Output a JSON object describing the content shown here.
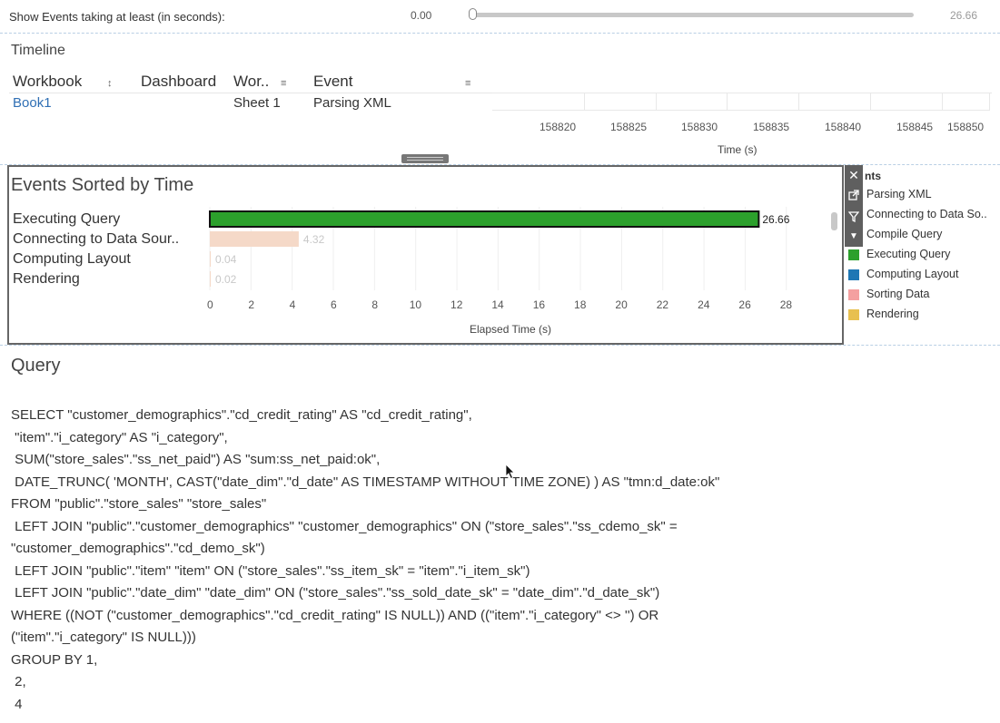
{
  "filter": {
    "label": "Show Events taking at least (in seconds):",
    "min_value": "0.00",
    "max_value": "26.66",
    "slider_level": 0
  },
  "timeline": {
    "title": "Timeline",
    "columns": [
      "Workbook",
      "Dashboard",
      "Wor..",
      "Event"
    ],
    "row": {
      "workbook": "Book1",
      "dashboard": "",
      "worksheet": "Sheet 1",
      "event": "Parsing XML"
    },
    "axis_ticks": [
      "158820",
      "158825",
      "158830",
      "158835",
      "158840",
      "158845",
      "158850"
    ],
    "axis_title": "Time (s)"
  },
  "events": {
    "title": "Events Sorted by Time",
    "x_axis_title": "Elapsed Time (s)",
    "ticks": [
      "0",
      "2",
      "4",
      "6",
      "8",
      "10",
      "12",
      "14",
      "16",
      "18",
      "20",
      "22",
      "24",
      "26",
      "28"
    ]
  },
  "chart_data": {
    "type": "bar",
    "orientation": "horizontal",
    "categories": [
      "Executing Query",
      "Connecting to Data Sour..",
      "Computing Layout",
      "Rendering"
    ],
    "values": [
      26.66,
      4.32,
      0.04,
      0.02
    ],
    "value_labels": [
      "26.66",
      "4.32",
      "0.04",
      "0.02"
    ],
    "colors": [
      "#2ca02c",
      "#f5d9c8",
      "#f5d9c8",
      "#f5d9c8"
    ],
    "xlabel": "Elapsed Time (s)",
    "xlim": [
      0,
      30
    ],
    "grid": true
  },
  "legend": {
    "title": "nts",
    "items": [
      {
        "label": "Parsing XML",
        "color": ""
      },
      {
        "label": "Connecting to Data So..",
        "color": ""
      },
      {
        "label": "Compile Query",
        "color": ""
      },
      {
        "label": "Executing Query",
        "color": "#2ca02c"
      },
      {
        "label": "Computing Layout",
        "color": "#1f77b4"
      },
      {
        "label": "Sorting Data",
        "color": "#f4a0a0"
      },
      {
        "label": "Rendering",
        "color": "#e8c050"
      }
    ]
  },
  "toolbar": {
    "icons": [
      "close-icon",
      "popout-icon",
      "filter-icon",
      "dropdown-icon"
    ]
  },
  "query": {
    "title": "Query",
    "text": "SELECT \"customer_demographics\".\"cd_credit_rating\" AS \"cd_credit_rating\",\n \"item\".\"i_category\" AS \"i_category\",\n SUM(\"store_sales\".\"ss_net_paid\") AS \"sum:ss_net_paid:ok\",\n DATE_TRUNC( 'MONTH', CAST(\"date_dim\".\"d_date\" AS TIMESTAMP WITHOUT TIME ZONE) ) AS \"tmn:d_date:ok\"\nFROM \"public\".\"store_sales\" \"store_sales\"\n LEFT JOIN \"public\".\"customer_demographics\" \"customer_demographics\" ON (\"store_sales\".\"ss_cdemo_sk\" =\n\"customer_demographics\".\"cd_demo_sk\")\n LEFT JOIN \"public\".\"item\" \"item\" ON (\"store_sales\".\"ss_item_sk\" = \"item\".\"i_item_sk\")\n LEFT JOIN \"public\".\"date_dim\" \"date_dim\" ON (\"store_sales\".\"ss_sold_date_sk\" = \"date_dim\".\"d_date_sk\")\nWHERE ((NOT (\"customer_demographics\".\"cd_credit_rating\" IS NULL)) AND ((\"item\".\"i_category\" <> '') OR\n(\"item\".\"i_category\" IS NULL)))\nGROUP BY 1,\n 2,\n 4"
  }
}
